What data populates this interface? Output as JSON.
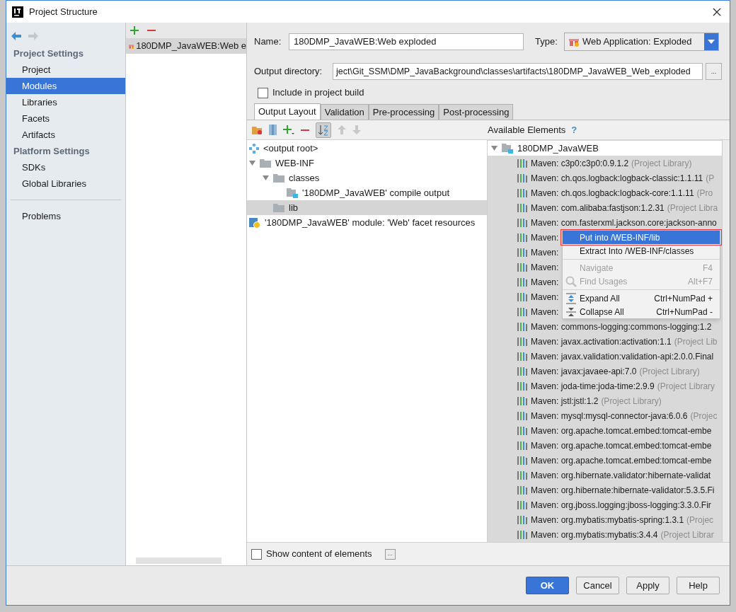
{
  "window": {
    "title": "Project Structure"
  },
  "sidebar": {
    "sections": [
      {
        "heading": "Project Settings",
        "items": [
          {
            "label": "Project",
            "selected": false
          },
          {
            "label": "Modules",
            "selected": true
          },
          {
            "label": "Libraries",
            "selected": false
          },
          {
            "label": "Facets",
            "selected": false
          },
          {
            "label": "Artifacts",
            "selected": false
          }
        ]
      },
      {
        "heading": "Platform Settings",
        "items": [
          {
            "label": "SDKs",
            "selected": false
          },
          {
            "label": "Global Libraries",
            "selected": false
          }
        ]
      }
    ],
    "bottom_items": [
      {
        "label": "Problems",
        "selected": false
      }
    ]
  },
  "artifacts": [
    {
      "label": "180DMP_JavaWEB:Web e",
      "selected": true
    }
  ],
  "form": {
    "name_label": "Name:",
    "name": "180DMP_JavaWEB:Web exploded",
    "type_label": "Type:",
    "type": "Web Application: Exploded",
    "output_label": "Output directory:",
    "output": "ject\\Git_SSM\\DMP_JavaBackground\\classes\\artifacts\\180DMP_JavaWEB_Web_exploded",
    "browse": "...",
    "include_label": "Include in project build",
    "include_checked": false
  },
  "tabs": [
    {
      "label": "Output Layout",
      "selected": true
    },
    {
      "label": "Validation",
      "selected": false
    },
    {
      "label": "Pre-processing",
      "selected": false
    },
    {
      "label": "Post-processing",
      "selected": false
    }
  ],
  "available_title": "Available Elements",
  "help": "?",
  "output_tree": [
    {
      "label": "<output root>",
      "kind": "root",
      "selected": false
    },
    {
      "label": "WEB-INF",
      "kind": "folder",
      "expanded": true,
      "selected": false,
      "children": [
        {
          "label": "classes",
          "kind": "folder",
          "expanded": true,
          "selected": false,
          "children": [
            {
              "label": "'180DMP_JavaWEB' compile output",
              "kind": "output",
              "selected": false
            }
          ]
        },
        {
          "label": "lib",
          "kind": "folder",
          "selected": true
        }
      ]
    },
    {
      "label": "'180DMP_JavaWEB' module: 'Web' facet resources",
      "kind": "facet",
      "selected": false
    }
  ],
  "available_tree": {
    "label": "180DMP_JavaWEB",
    "expanded": true,
    "children": [
      {
        "name": "Maven: c3p0:c3p0:0.9.1.2",
        "suffix": "(Project Library)"
      },
      {
        "name": "Maven: ch.qos.logback:logback-classic:1.1.11",
        "suffix": "(P"
      },
      {
        "name": "Maven: ch.qos.logback:logback-core:1.1.11",
        "suffix": "(Pro"
      },
      {
        "name": "Maven: com.alibaba:fastjson:1.2.31",
        "suffix": "(Project Libra"
      },
      {
        "name": "Maven: com.fasterxml.jackson.core:jackson-anno"
      },
      {
        "name": "Maven:"
      },
      {
        "name": "Maven:"
      },
      {
        "name": "Maven:"
      },
      {
        "name": "Maven:"
      },
      {
        "name": "Maven:"
      },
      {
        "name": "Maven:"
      },
      {
        "name": "Maven: commons-logging:commons-logging:1.2"
      },
      {
        "name": "Maven: javax.activation:activation:1.1",
        "suffix": "(Project Lib"
      },
      {
        "name": "Maven: javax.validation:validation-api:2.0.0.Final"
      },
      {
        "name": "Maven: javax:javaee-api:7.0",
        "suffix": "(Project Library)"
      },
      {
        "name": "Maven: joda-time:joda-time:2.9.9",
        "suffix": "(Project Library"
      },
      {
        "name": "Maven: jstl:jstl:1.2",
        "suffix": "(Project Library)"
      },
      {
        "name": "Maven: mysql:mysql-connector-java:6.0.6",
        "suffix": "(Projec"
      },
      {
        "name": "Maven: org.apache.tomcat.embed:tomcat-embe"
      },
      {
        "name": "Maven: org.apache.tomcat.embed:tomcat-embe"
      },
      {
        "name": "Maven: org.apache.tomcat.embed:tomcat-embe"
      },
      {
        "name": "Maven: org.hibernate.validator:hibernate-validat"
      },
      {
        "name": "Maven: org.hibernate:hibernate-validator:5.3.5.Fi"
      },
      {
        "name": "Maven: org.jboss.logging:jboss-logging:3.3.0.Fir"
      },
      {
        "name": "Maven: org.mybatis:mybatis-spring:1.3.1",
        "suffix": "(Projec"
      },
      {
        "name": "Maven: org.mybatis:mybatis:3.4.4",
        "suffix": "(Project Librar"
      }
    ]
  },
  "context_menu": [
    {
      "label": "Put into /WEB-INF/lib",
      "kind": "item",
      "selected": true,
      "disabled": false
    },
    {
      "label": "Extract Into /WEB-INF/classes",
      "kind": "item",
      "selected": false,
      "disabled": false
    },
    {
      "kind": "separator"
    },
    {
      "label": "Navigate",
      "shortcut": "F4",
      "kind": "item",
      "selected": false,
      "disabled": true
    },
    {
      "label": "Find Usages",
      "shortcut": "Alt+F7",
      "kind": "find",
      "selected": false,
      "disabled": true
    },
    {
      "kind": "separator"
    },
    {
      "label": "Expand All",
      "shortcut": "Ctrl+NumPad +",
      "kind": "expand",
      "selected": false,
      "disabled": false
    },
    {
      "label": "Collapse All",
      "shortcut": "Ctrl+NumPad -",
      "kind": "collapse",
      "selected": false,
      "disabled": false
    }
  ],
  "show_content": {
    "label": "Show content of elements",
    "checked": false,
    "browse": "..."
  },
  "buttons": [
    {
      "label": "OK",
      "default": true
    },
    {
      "label": "Cancel",
      "default": false
    },
    {
      "label": "Apply",
      "default": false
    },
    {
      "label": "Help",
      "default": false
    }
  ]
}
